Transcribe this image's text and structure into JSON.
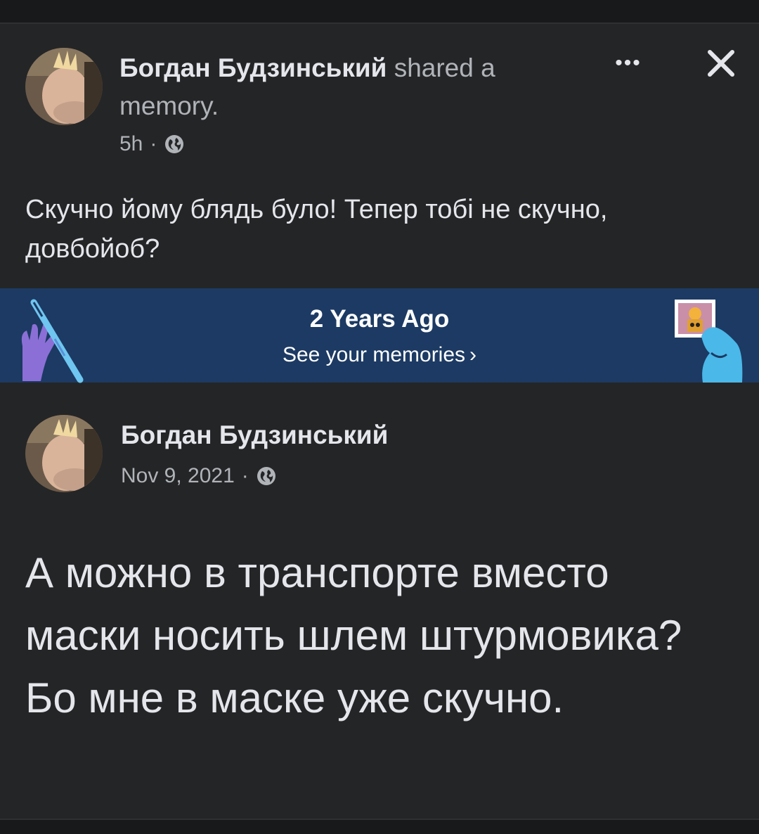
{
  "shared_post": {
    "author": "Богдан Будзинський",
    "action": "shared a memory.",
    "time": "5h",
    "separator": "·",
    "privacy_icon": "globe-icon",
    "more_label": "•••",
    "close_icon": "close-icon",
    "caption": "Скучно йому блядь було! Тепер тобі не скучно, довбойоб?"
  },
  "memories_banner": {
    "title": "2 Years Ago",
    "link": "See your memories",
    "chevron": "›",
    "background_color": "#1c3a63"
  },
  "original_post": {
    "author": "Богдан Будзинський",
    "date": "Nov 9, 2021",
    "separator": "·",
    "privacy_icon": "globe-icon",
    "text": "А можно в транспорте вместо маски носить шлем штурмовика? Бо мне в маске уже скучно."
  },
  "colors": {
    "post_background": "#242526",
    "primary_text": "#e4e6eb",
    "secondary_text": "#b0b3b8"
  }
}
